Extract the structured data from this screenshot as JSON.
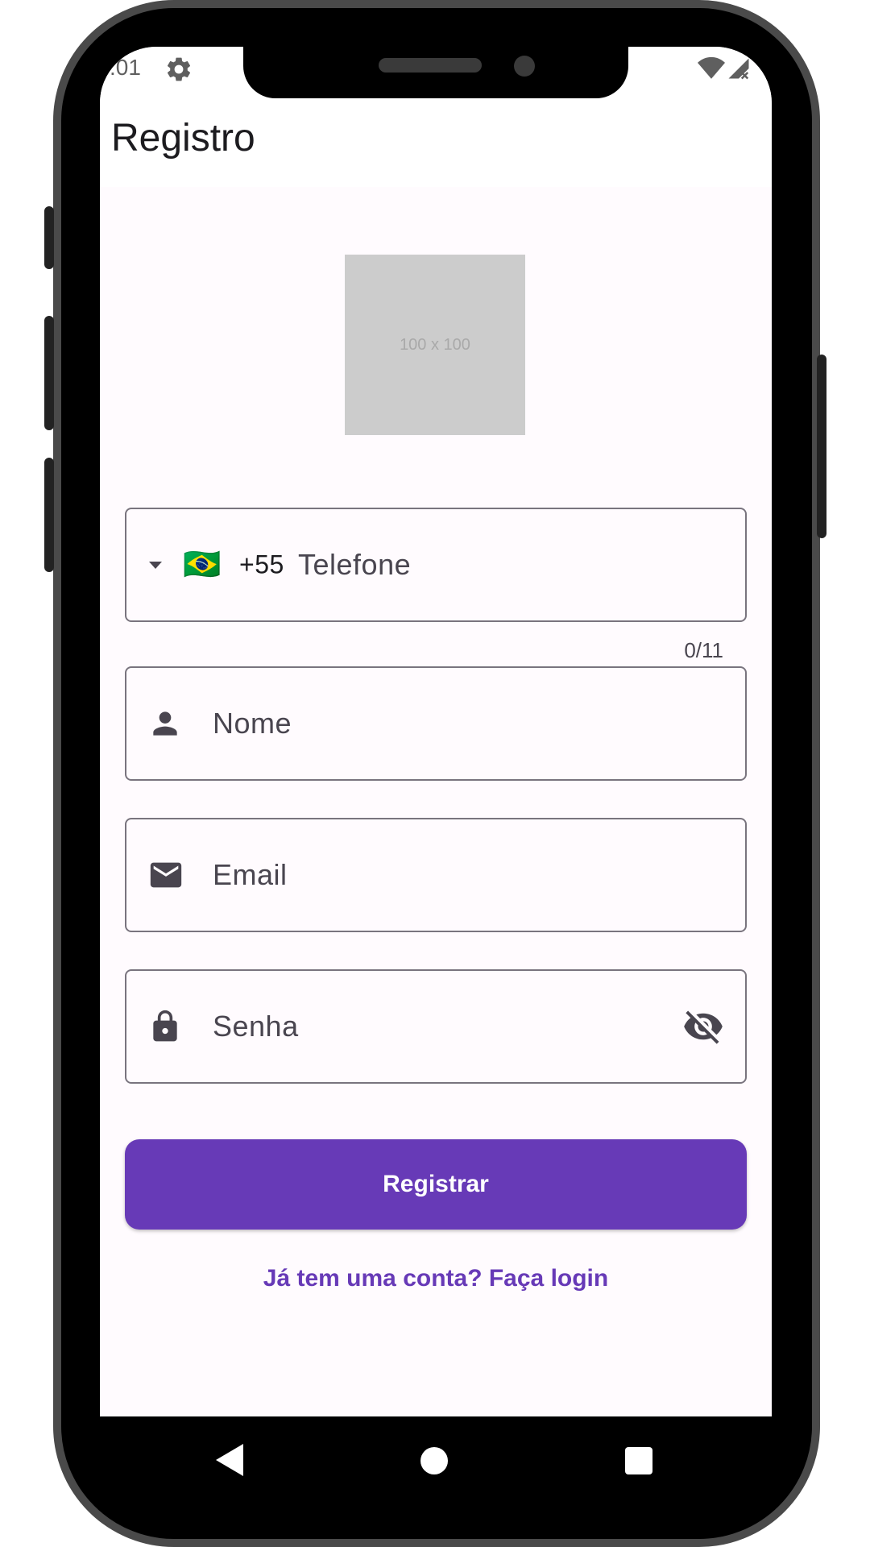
{
  "status_bar": {
    "time": ":01"
  },
  "app_bar": {
    "title": "Registro"
  },
  "logo": {
    "placeholder_text": "100 x 100"
  },
  "form": {
    "phone": {
      "flag": "🇧🇷",
      "country_code": "+55",
      "label": "Telefone",
      "counter": "0/11"
    },
    "name": {
      "label": "Nome",
      "icon": "person-icon"
    },
    "email": {
      "label": "Email",
      "icon": "mail-icon"
    },
    "password": {
      "label": "Senha",
      "icon": "lock-icon",
      "toggle_icon": "visibility-off-icon"
    }
  },
  "actions": {
    "register_label": "Registrar",
    "login_link": "Já tem uma conta? Faça login"
  },
  "colors": {
    "primary": "#673ab7",
    "background": "#fffbfe",
    "outline": "#79747e",
    "on_surface_variant": "#49454f"
  }
}
